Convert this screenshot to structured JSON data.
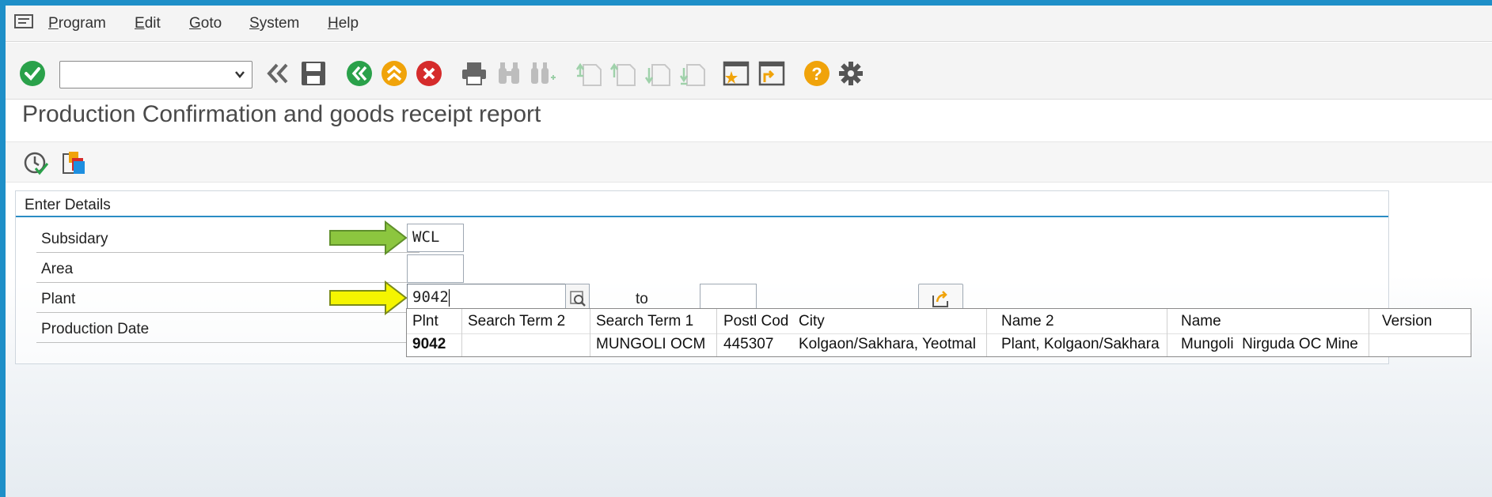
{
  "menu": {
    "items": [
      {
        "mnemonic": "P",
        "rest": "rogram"
      },
      {
        "mnemonic": "E",
        "rest": "dit"
      },
      {
        "mnemonic": "G",
        "rest": "oto"
      },
      {
        "mnemonic": "S",
        "rest": "ystem"
      },
      {
        "mnemonic": "H",
        "rest": "elp"
      }
    ]
  },
  "toolbar": {
    "command_field_value": "",
    "icons": [
      "enter-check-icon",
      "command-dropdown-icon",
      "back-double-icon",
      "save-icon",
      "back-icon",
      "exit-icon",
      "cancel-icon",
      "print-icon",
      "find-icon",
      "find-next-icon",
      "first-page-icon",
      "previous-page-icon",
      "next-page-icon",
      "last-page-icon",
      "create-session-icon",
      "shortcut-icon",
      "help-icon",
      "settings-gear-icon"
    ]
  },
  "page": {
    "title": "Production Confirmation and goods receipt report"
  },
  "app_toolbar": {
    "icons": [
      "execute-icon",
      "get-variant-icon"
    ]
  },
  "form": {
    "group_title": "Enter Details",
    "fields": {
      "subsidary_label": "Subsidary",
      "subsidary_value": "WCL",
      "area_label": "Area",
      "area_value": "",
      "plant_label": "Plant",
      "plant_value": "9042",
      "plant_to_label": "to",
      "plant_to_value": "",
      "production_date_label": "Production Date"
    },
    "arrow_colors": {
      "subsidary": "#8cc63f",
      "plant": "#f5f500"
    }
  },
  "search_help": {
    "headers": [
      "Plnt",
      "Search Term 2",
      "Search Term 1",
      "Postl Cod",
      "City",
      "Name 2",
      "Name",
      "Version"
    ],
    "rows": [
      [
        "9042",
        "",
        "MUNGOLI OCM",
        "445307",
        "Kolgaon/Sakhara, Yeotmal",
        "Plant, Kolgaon/Sakhara",
        "Mungoli  Nirguda OC Mine",
        ""
      ]
    ]
  },
  "colors": {
    "accent_blue": "#2a8cc4",
    "ok_green": "#2aa14a",
    "cancel_red": "#d52b2b",
    "warn_orange": "#f0a30a"
  }
}
